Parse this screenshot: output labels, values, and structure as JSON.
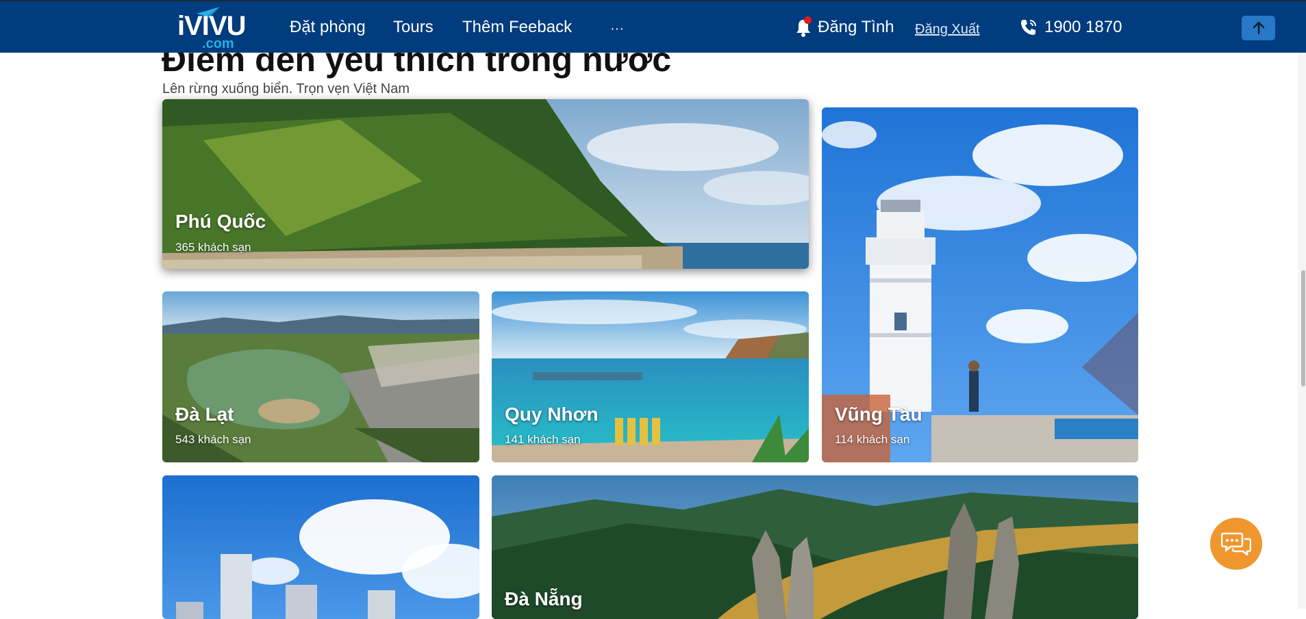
{
  "header": {
    "logo": {
      "word": "iVIVU",
      "sub": ".com"
    },
    "nav": [
      {
        "label": "Đặt phòng"
      },
      {
        "label": "Tours"
      },
      {
        "label": "Thêm Feeback"
      },
      {
        "label": "···"
      }
    ],
    "user": {
      "name": "Đăng Tình",
      "logout": "Đăng Xuất"
    },
    "phone": "1900 1870"
  },
  "section": {
    "title": "Điểm đến yêu thích trong nước",
    "subtitle": "Lên rừng xuống biển. Trọn vẹn Việt Nam"
  },
  "destinations": [
    {
      "name": "Phú Quốc",
      "count": "365 khách sạn"
    },
    {
      "name": "Đà Lạt",
      "count": "543 khách sạn"
    },
    {
      "name": "Quy Nhơn",
      "count": "141 khách sạn"
    },
    {
      "name": "Vũng Tàu",
      "count": "114 khách sạn"
    },
    {
      "name": "Đà Nẵng",
      "count": ""
    }
  ],
  "colors": {
    "header_bg": "#003c7e",
    "accent_blue": "#2878c8",
    "logo_cyan": "#27b0e6",
    "chat_orange": "#f0962e",
    "notification_red": "#e31b1b"
  },
  "icons": [
    "paper-plane-icon",
    "bell-icon",
    "phone-icon",
    "arrow-up-icon",
    "chat-icon"
  ]
}
